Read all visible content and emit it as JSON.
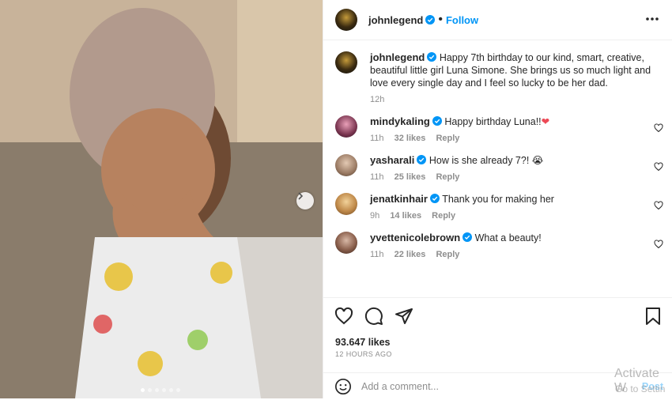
{
  "header": {
    "username": "johnlegend",
    "follow_label": "Follow"
  },
  "caption": {
    "username": "johnlegend",
    "text": "Happy 7th birthday to our kind, smart, creative, beautiful little girl Luna Simone. She brings us so much light and love every single day and I feel so lucky to be her dad.",
    "time": "12h"
  },
  "comments": [
    {
      "username": "mindykaling",
      "text": "Happy birthday Luna!!",
      "emoji": "❤",
      "time": "11h",
      "likes": "32 likes",
      "reply": "Reply"
    },
    {
      "username": "yasharali",
      "text": "How is she already 7?!",
      "emoji": "😭",
      "time": "11h",
      "likes": "25 likes",
      "reply": "Reply"
    },
    {
      "username": "jenatkinhair",
      "text": "Thank you for making her",
      "emoji": "",
      "time": "9h",
      "likes": "14 likes",
      "reply": "Reply"
    },
    {
      "username": "yvettenicolebrown",
      "text": "What a beauty!",
      "emoji": "",
      "time": "11h",
      "likes": "22 likes",
      "reply": "Reply"
    }
  ],
  "actions": {
    "likes": "93.647 likes",
    "time_ago": "12 HOURS AGO"
  },
  "add_comment": {
    "placeholder": "Add a comment...",
    "post_label": "Post"
  },
  "carousel": {
    "dot_count": 6,
    "active_index": 0
  },
  "watermark": {
    "line1": "Activate W",
    "line2": "Go to Settin"
  },
  "colors": {
    "accent": "#0095f6",
    "heart": "#ed4956"
  },
  "icons": [
    "more-icon",
    "verified-icon",
    "heart-icon",
    "comment-icon",
    "share-icon",
    "bookmark-icon",
    "emoji-icon",
    "chevron-right-icon"
  ]
}
